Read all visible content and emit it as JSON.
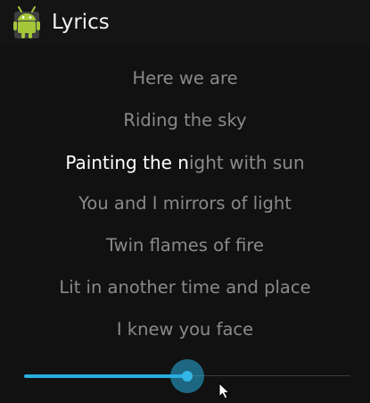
{
  "action_bar": {
    "title": "Lyrics",
    "icon": "android-robot-icon"
  },
  "lyrics": {
    "lines": [
      {
        "text": "Here we are"
      },
      {
        "text": "Riding the sky"
      },
      {
        "sung": "Painting the n",
        "unsung": "ight with sun"
      },
      {
        "text": "You and I mirrors of light"
      },
      {
        "text": "Twin flames of fire"
      },
      {
        "text": "Lit in another time and place"
      },
      {
        "text": "I knew you face"
      }
    ],
    "current_line_index": 2
  },
  "seekbar": {
    "progress": 0.5
  },
  "colors": {
    "background": "#111111",
    "accent": "#33b5e5",
    "dim_text": "#8a8a8a",
    "highlight_text": "#ffffff",
    "android_green": "#a4c639"
  }
}
